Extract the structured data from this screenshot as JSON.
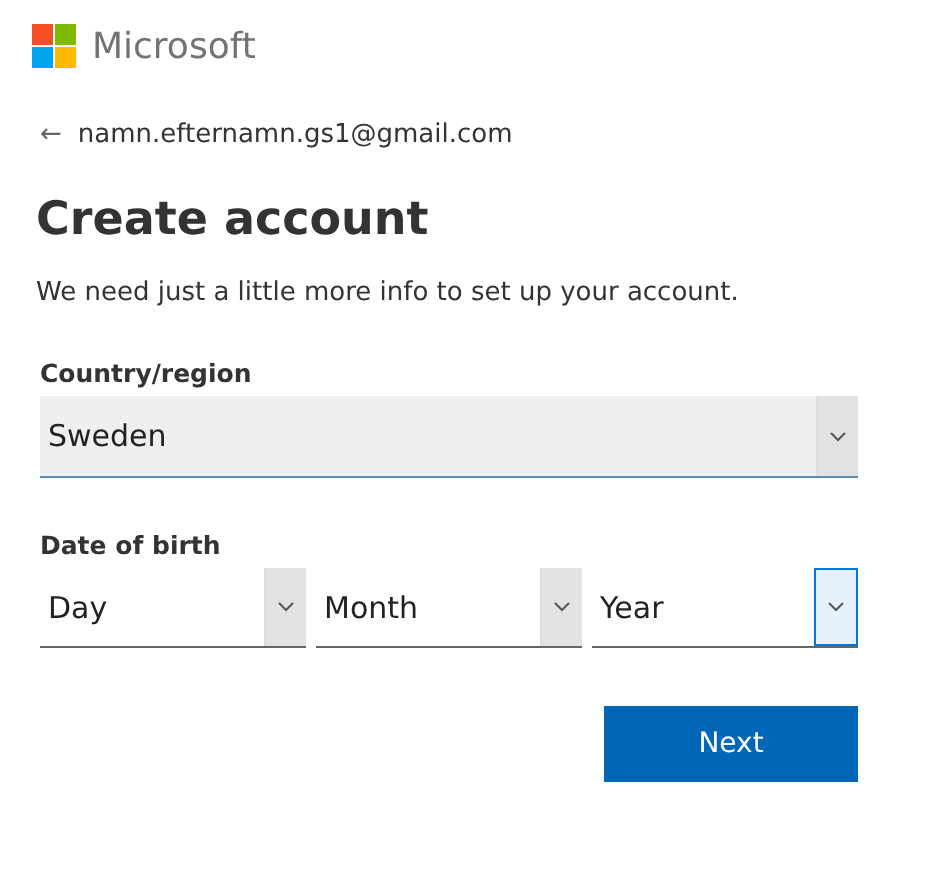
{
  "brand": {
    "name": "Microsoft"
  },
  "back_link": {
    "icon": "←",
    "email": "namn.efternamn.gs1@gmail.com"
  },
  "heading": "Create account",
  "intro": "We need just a little more info to set up your account.",
  "country": {
    "label": "Country/region",
    "value": "Sweden",
    "hovered": true
  },
  "date_of_birth": {
    "label": "Date of birth",
    "fields": [
      {
        "value": "Day",
        "focused": false
      },
      {
        "value": "Month",
        "focused": false
      },
      {
        "value": "Year",
        "focused": true
      }
    ]
  },
  "buttons": [
    {
      "label": "Next"
    }
  ]
}
